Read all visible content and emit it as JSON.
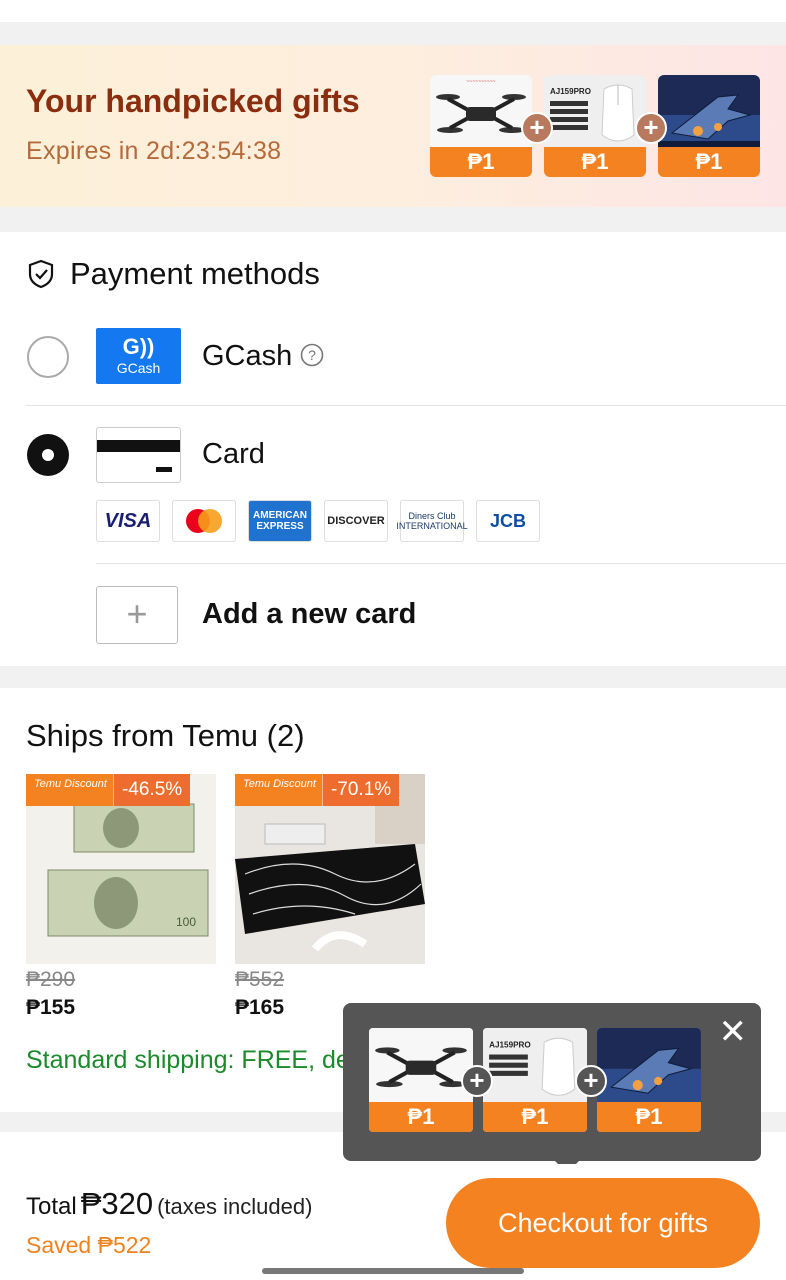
{
  "gifts_banner": {
    "title": "Your handpicked gifts",
    "expires": "Expires in 2d:23:54:38",
    "items": [
      {
        "price": "₱1",
        "icon": "drone-image"
      },
      {
        "price": "₱1",
        "icon": "mouse-image"
      },
      {
        "price": "₱1",
        "icon": "jet-monitor-image"
      }
    ]
  },
  "payment": {
    "title": "Payment methods",
    "options": [
      {
        "label": "GCash",
        "logo_text": "GCash",
        "selected": false
      },
      {
        "label": "Card",
        "selected": true
      }
    ],
    "card_brands": [
      "VISA",
      "Mastercard",
      "AMERICAN EXPRESS",
      "DISCOVER",
      "Diners Club INTERNATIONAL",
      "JCB"
    ],
    "add_card": "Add a new card"
  },
  "ships": {
    "title": "Ships from Temu (2)",
    "products": [
      {
        "badge_label": "Temu Discount",
        "discount": "-46.5%",
        "old_price": "₱290",
        "price": "₱155"
      },
      {
        "badge_label": "Temu Discount",
        "discount": "-70.1%",
        "old_price": "₱552",
        "price": "₱165"
      }
    ],
    "shipping": "Standard shipping: FREE, del"
  },
  "popup": {
    "prices": [
      "₱1",
      "₱1",
      "₱1"
    ]
  },
  "footer": {
    "total_label": "Total",
    "total_amount": "₱320",
    "tax_note": "(taxes included)",
    "saved": "Saved ₱522",
    "checkout": "Checkout for gifts"
  },
  "colors": {
    "accent": "#f58220",
    "gcash": "#1478f0",
    "shipping": "#1b8a2a",
    "title": "#8b2d0f"
  }
}
